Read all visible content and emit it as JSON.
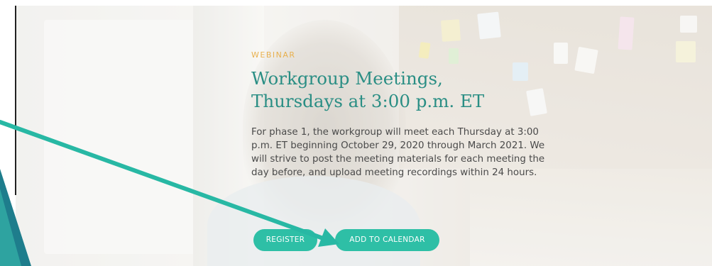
{
  "hero": {
    "eyebrow": "WEBINAR",
    "title_line1": "Workgroup Meetings,",
    "title_line2": "Thursdays at 3:00 p.m. ET",
    "body": "For phase 1, the workgroup will meet each Thursday at 3:00 p.m. ET beginning October 29, 2020 through March 2021. We will strive to post the meeting materials for each meeting the day before, and upload meeting recordings within 24 hours.",
    "buttons": {
      "register": "REGISTER",
      "add_to_calendar": "ADD TO CALENDAR"
    }
  },
  "colors": {
    "eyebrow": "#e8b04e",
    "title": "#2a8e84",
    "button": "#2ebfa6",
    "annotation_arrow": "#28b8a4",
    "corner_shape": "#1e7d8c"
  },
  "icons": {
    "annotation": "arrow-icon"
  }
}
